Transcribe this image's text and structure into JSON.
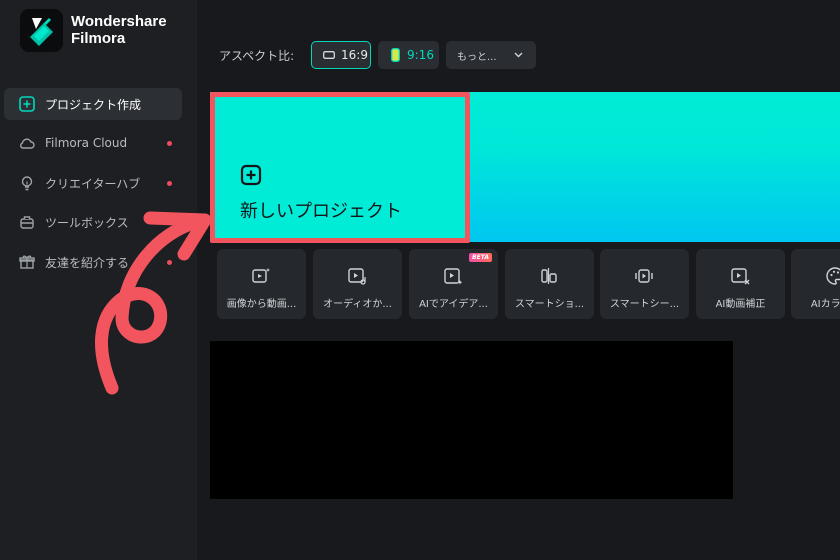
{
  "app": {
    "logo_line1": "Wondershare",
    "logo_line2": "Filmora",
    "accent_color": "#00d9bc",
    "highlight_color": "#f2555e"
  },
  "sidebar": {
    "items": [
      {
        "label": "プロジェクト作成",
        "icon": "plus-square-icon",
        "active": true
      },
      {
        "label": "Filmora Cloud",
        "icon": "cloud-icon",
        "dot": true
      },
      {
        "label": "クリエイターハブ",
        "icon": "lightbulb-icon",
        "dot": true
      },
      {
        "label": "ツールボックス",
        "icon": "toolbox-icon"
      },
      {
        "label": "友達を紹介する",
        "icon": "gift-icon",
        "dot": true
      }
    ]
  },
  "aspect": {
    "label": "アスペクト比:",
    "options": [
      {
        "label": "16:9",
        "selected": true
      },
      {
        "label": "9:16"
      }
    ],
    "more_label": "もっと..."
  },
  "banner": {
    "new_project_label": "新しいプロジェクト"
  },
  "tools": [
    {
      "label": "画像から動画...",
      "icon": "image-to-video-icon"
    },
    {
      "label": "オーディオか...",
      "icon": "audio-to-video-icon"
    },
    {
      "label": "AIでアイデア...",
      "icon": "ai-idea-icon",
      "badge": "BETA"
    },
    {
      "label": "スマートショ...",
      "icon": "smart-short-icon"
    },
    {
      "label": "スマートシー...",
      "icon": "smart-scene-icon"
    },
    {
      "label": "AI動画補正",
      "icon": "ai-enhance-icon"
    },
    {
      "label": "AIカラー...",
      "icon": "ai-color-icon"
    }
  ]
}
